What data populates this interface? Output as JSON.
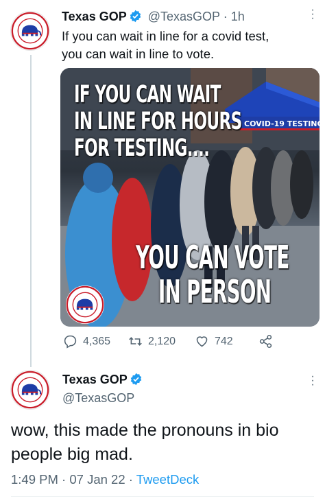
{
  "tweet": {
    "author_name": "Texas GOP",
    "handle": "@TexasGOP",
    "separator": "·",
    "time_ago": "1h",
    "text_line1": "If you can wait in line for a covid test,",
    "text_line2": "you can wait in line to vote.",
    "media": {
      "caption_top": [
        "IF YOU CAN WAIT",
        "IN LINE FOR HOURS",
        "FOR TESTING...."
      ],
      "caption_bottom": [
        "YOU CAN VOTE",
        "IN PERSON"
      ],
      "sign_text": "COVID-19 TESTING"
    },
    "stats": {
      "replies": "4,365",
      "retweets": "2,120",
      "likes": "742"
    }
  },
  "reply_tweet": {
    "author_name": "Texas GOP",
    "handle": "@TexasGOP",
    "text": "wow, this made the pronouns in bio people big mad.",
    "time": "1:49 PM",
    "date": "07 Jan 22",
    "source": "TweetDeck",
    "separator": "·"
  },
  "icons": {
    "verified": "verified-badge-icon",
    "reply": "reply-icon",
    "retweet": "retweet-icon",
    "like": "heart-icon",
    "share": "share-icon",
    "more": "more-options-icon"
  },
  "colors": {
    "accent": "#1d9bf0",
    "muted_text": "#536471",
    "seal_red": "#c91d2a",
    "seal_blue": "#1e3da6"
  }
}
